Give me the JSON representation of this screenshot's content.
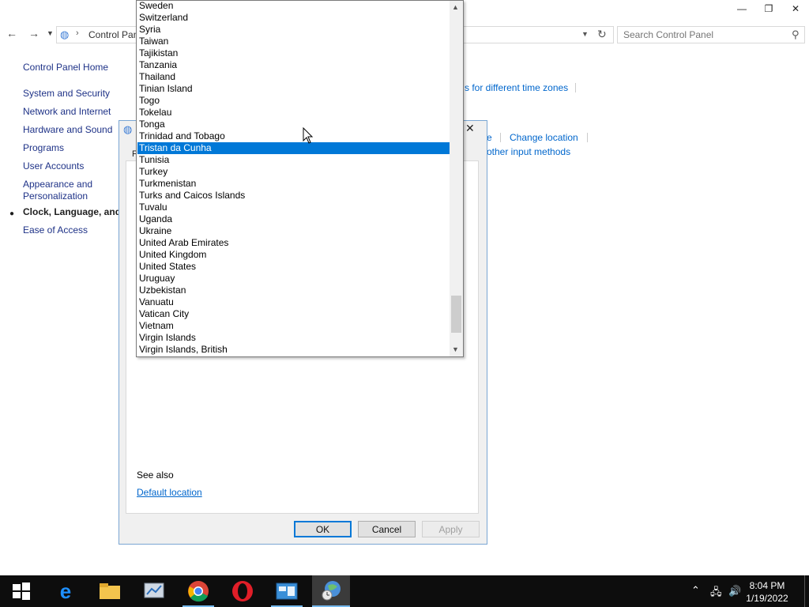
{
  "window": {
    "address_crumb": "Control Panel",
    "search_placeholder": "Search Control Panel",
    "minimize": "—",
    "restore": "❐",
    "close": "✕"
  },
  "sidebar": {
    "home": "Control Panel Home",
    "items": [
      {
        "label": "System and Security"
      },
      {
        "label": "Network and Internet"
      },
      {
        "label": "Hardware and Sound"
      },
      {
        "label": "Programs"
      },
      {
        "label": "User Accounts"
      },
      {
        "label": "Appearance and"
      },
      {
        "label": "Personalization"
      },
      {
        "label": "Clock, Language, and R"
      },
      {
        "label": "Ease of Access"
      }
    ]
  },
  "main_links": {
    "time_zones": "s for different time zones",
    "partial_e": "e",
    "change_location": "Change location",
    "input_methods": "other input methods"
  },
  "dialog": {
    "see_also": "See also",
    "default_location": "Default location",
    "ok": "OK",
    "cancel": "Cancel",
    "apply": "Apply",
    "close": "✕",
    "tab_partial": "F"
  },
  "dropdown": {
    "selected": "Tristan da Cunha",
    "items": [
      "Sweden",
      "Switzerland",
      "Syria",
      "Taiwan",
      "Tajikistan",
      "Tanzania",
      "Thailand",
      "Tinian Island",
      "Togo",
      "Tokelau",
      "Tonga",
      "Trinidad and Tobago",
      "Tristan da Cunha",
      "Tunisia",
      "Turkey",
      "Turkmenistan",
      "Turks and Caicos Islands",
      "Tuvalu",
      "Uganda",
      "Ukraine",
      "United Arab Emirates",
      "United Kingdom",
      "United States",
      "Uruguay",
      "Uzbekistan",
      "Vanuatu",
      "Vatican City",
      "Vietnam",
      "Virgin Islands",
      "Virgin Islands, British"
    ]
  },
  "taskbar": {
    "time": "8:04 PM",
    "date": "1/19/2022",
    "apps": [
      "start-icon",
      "edge-icon",
      "file-explorer-icon",
      "server-manager-icon",
      "chrome-icon",
      "opera-icon",
      "control-panel-icon",
      "region-icon"
    ]
  }
}
